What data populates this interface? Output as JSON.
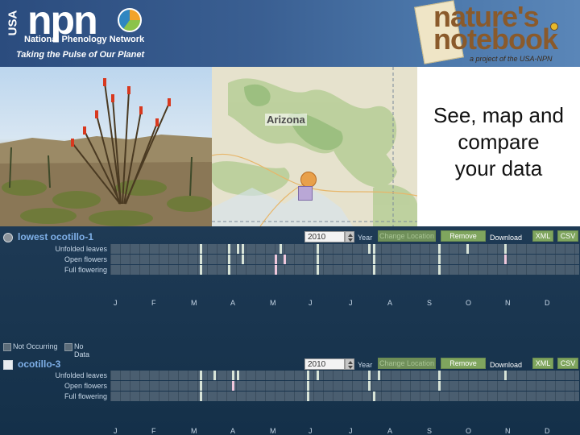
{
  "header": {
    "usa": "USA",
    "npn_word": "npn",
    "org_name": "National Phenology Network",
    "tagline": "Taking the Pulse of Our Planet",
    "nn_line1": "nature's",
    "nn_line2": "notebook",
    "nn_sub": "a project of the USA-NPN"
  },
  "map": {
    "label": "Arizona"
  },
  "promo": {
    "line1": "See, map and",
    "line2": "compare",
    "line3": "your data"
  },
  "controls": {
    "year_unit": "Year",
    "change_location": "Change Location",
    "remove": "Remove",
    "download": "Download",
    "xml": "XML",
    "csv": "CSV"
  },
  "months": [
    "J",
    "F",
    "M",
    "A",
    "M",
    "J",
    "J",
    "A",
    "S",
    "O",
    "N",
    "D"
  ],
  "legend": {
    "not_occurring": "Not Occurring",
    "no_data": "No Data"
  },
  "colors": {
    "occurring_yes": "#f0c8dc",
    "occurring_no": "#d8e4d8",
    "panel_bg": "#1e3a55"
  },
  "stations": [
    {
      "name": "lowest ocotillo-1",
      "year": "2010",
      "phenophases": [
        {
          "label": "Unfolded leaves",
          "observations": [
            {
              "t": 0.19,
              "c": "no"
            },
            {
              "t": 0.25,
              "c": "no"
            },
            {
              "t": 0.27,
              "c": "no"
            },
            {
              "t": 0.28,
              "c": "no"
            },
            {
              "t": 0.36,
              "c": "no"
            },
            {
              "t": 0.44,
              "c": "no"
            },
            {
              "t": 0.55,
              "c": "no"
            },
            {
              "t": 0.56,
              "c": "no"
            },
            {
              "t": 0.7,
              "c": "no"
            },
            {
              "t": 0.76,
              "c": "no"
            },
            {
              "t": 0.84,
              "c": "no"
            }
          ]
        },
        {
          "label": "Open flowers",
          "observations": [
            {
              "t": 0.19,
              "c": "no"
            },
            {
              "t": 0.25,
              "c": "no"
            },
            {
              "t": 0.28,
              "c": "no"
            },
            {
              "t": 0.35,
              "c": "yes"
            },
            {
              "t": 0.37,
              "c": "yes"
            },
            {
              "t": 0.44,
              "c": "no"
            },
            {
              "t": 0.56,
              "c": "no"
            },
            {
              "t": 0.7,
              "c": "no"
            },
            {
              "t": 0.84,
              "c": "yes"
            }
          ]
        },
        {
          "label": "Full flowering",
          "observations": [
            {
              "t": 0.19,
              "c": "no"
            },
            {
              "t": 0.25,
              "c": "no"
            },
            {
              "t": 0.35,
              "c": "yes"
            },
            {
              "t": 0.44,
              "c": "no"
            },
            {
              "t": 0.56,
              "c": "no"
            },
            {
              "t": 0.7,
              "c": "no"
            }
          ]
        }
      ]
    },
    {
      "name": "ocotillo-3",
      "year": "2010",
      "phenophases": [
        {
          "label": "Unfolded leaves",
          "observations": [
            {
              "t": 0.19,
              "c": "no"
            },
            {
              "t": 0.22,
              "c": "no"
            },
            {
              "t": 0.26,
              "c": "no"
            },
            {
              "t": 0.27,
              "c": "no"
            },
            {
              "t": 0.42,
              "c": "no"
            },
            {
              "t": 0.44,
              "c": "no"
            },
            {
              "t": 0.55,
              "c": "no"
            },
            {
              "t": 0.57,
              "c": "no"
            },
            {
              "t": 0.7,
              "c": "no"
            },
            {
              "t": 0.84,
              "c": "no"
            }
          ]
        },
        {
          "label": "Open flowers",
          "observations": [
            {
              "t": 0.19,
              "c": "no"
            },
            {
              "t": 0.26,
              "c": "yes"
            },
            {
              "t": 0.42,
              "c": "no"
            },
            {
              "t": 0.55,
              "c": "no"
            },
            {
              "t": 0.7,
              "c": "no"
            }
          ]
        },
        {
          "label": "Full flowering",
          "observations": [
            {
              "t": 0.19,
              "c": "no"
            },
            {
              "t": 0.42,
              "c": "no"
            },
            {
              "t": 0.56,
              "c": "no"
            }
          ]
        }
      ]
    }
  ]
}
